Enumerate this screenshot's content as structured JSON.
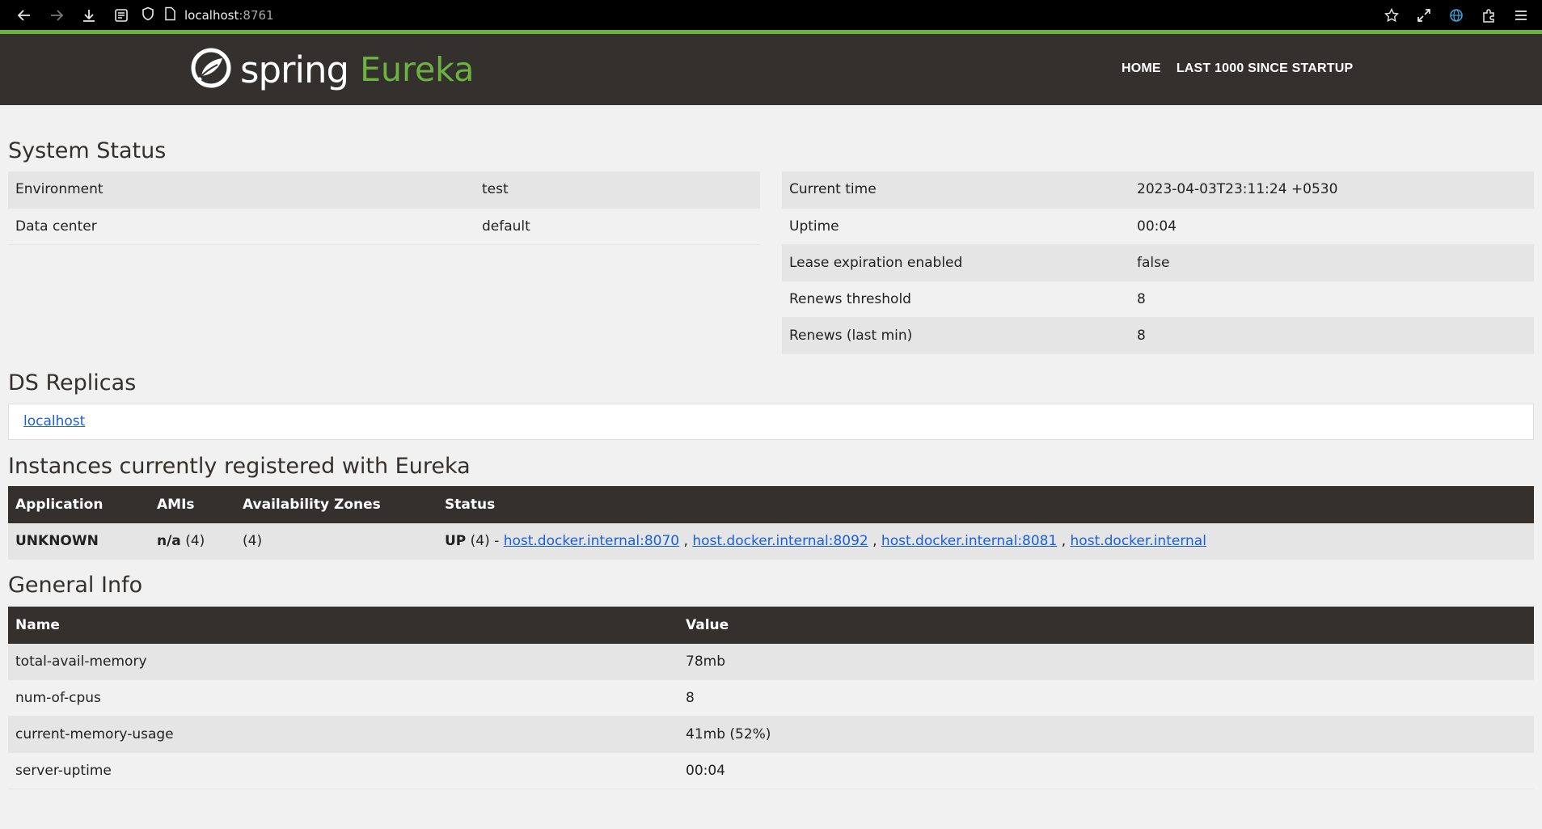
{
  "browser": {
    "url_host": "localhost",
    "url_port": ":8761"
  },
  "header": {
    "brand_spring": "spring",
    "brand_eureka": "Eureka",
    "nav": [
      {
        "label": "HOME"
      },
      {
        "label": "LAST 1000 SINCE STARTUP"
      }
    ]
  },
  "system_status": {
    "title": "System Status",
    "left": [
      {
        "key": "Environment",
        "value": "test"
      },
      {
        "key": "Data center",
        "value": "default"
      }
    ],
    "right": [
      {
        "key": "Current time",
        "value": "2023-04-03T23:11:24 +0530"
      },
      {
        "key": "Uptime",
        "value": "00:04"
      },
      {
        "key": "Lease expiration enabled",
        "value": "false"
      },
      {
        "key": "Renews threshold",
        "value": "8"
      },
      {
        "key": "Renews (last min)",
        "value": "8"
      }
    ]
  },
  "ds_replicas": {
    "title": "DS Replicas",
    "link": "localhost"
  },
  "instances": {
    "title": "Instances currently registered with Eureka",
    "columns": [
      "Application",
      "AMIs",
      "Availability Zones",
      "Status"
    ],
    "row": {
      "application": "UNKNOWN",
      "amis_bold": "n/a",
      "amis_count": " (4)",
      "zones": "(4)",
      "status_bold": "UP",
      "status_prefix": " (4) - ",
      "links": [
        "host.docker.internal:8070",
        "host.docker.internal:8092",
        "host.docker.internal:8081",
        "host.docker.internal"
      ]
    }
  },
  "general_info": {
    "title": "General Info",
    "columns": [
      "Name",
      "Value"
    ],
    "rows": [
      {
        "name": "total-avail-memory",
        "value": "78mb"
      },
      {
        "name": "num-of-cpus",
        "value": "8"
      },
      {
        "name": "current-memory-usage",
        "value": "41mb (52%)"
      },
      {
        "name": "server-uptime",
        "value": "00:04"
      }
    ]
  }
}
